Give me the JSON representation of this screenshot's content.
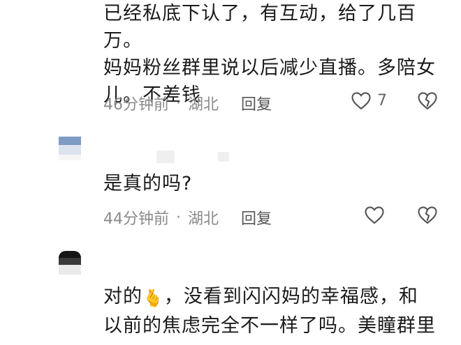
{
  "comment1": {
    "lines": [
      "已经私底下认了，有互动，给了几百万。",
      "妈妈粉丝群里说以后减少直播。多陪女",
      "儿。不差钱"
    ],
    "time": "46分钟前",
    "location": "湖北",
    "reply_label": "回复",
    "like_count": "7"
  },
  "comment2": {
    "text": "是真的吗?",
    "time": "44分钟前",
    "location": "湖北",
    "reply_label": "回复"
  },
  "comment3": {
    "line1_prefix": "对的",
    "line1_emoji": "🫰",
    "line1_suffix": "，没看到闪闪妈的幸福感，和",
    "line2": "以前的焦虑完全不一样了吗。美瞳群里"
  },
  "separator": "·",
  "icons": {
    "like": "heart-outline-icon",
    "dislike": "broken-heart-icon"
  },
  "colors": {
    "text": "#1a1a1a",
    "meta": "#8a8a8a",
    "icon": "#555555"
  }
}
